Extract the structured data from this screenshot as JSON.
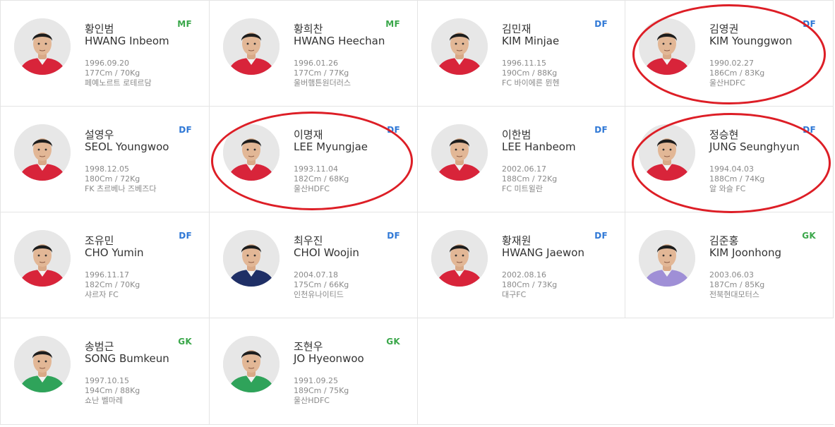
{
  "players": [
    {
      "kname": "황인범",
      "ename": "HWANG Inbeom",
      "pos": "MF",
      "dob": "1996.09.20",
      "body": "177Cm / 70Kg",
      "club": "페예노르트 로테르담",
      "kit": "red"
    },
    {
      "kname": "황희찬",
      "ename": "HWANG Heechan",
      "pos": "MF",
      "dob": "1996.01.26",
      "body": "177Cm / 77Kg",
      "club": "울버햄튼원더러스",
      "kit": "red"
    },
    {
      "kname": "김민재",
      "ename": "KIM Minjae",
      "pos": "DF",
      "dob": "1996.11.15",
      "body": "190Cm / 88Kg",
      "club": "FC 바이에른 뮌헨",
      "kit": "red"
    },
    {
      "kname": "김영권",
      "ename": "KIM Younggwon",
      "pos": "DF",
      "dob": "1990.02.27",
      "body": "186Cm / 83Kg",
      "club": "울산HDFC",
      "kit": "red"
    },
    {
      "kname": "설영우",
      "ename": "SEOL Youngwoo",
      "pos": "DF",
      "dob": "1998.12.05",
      "body": "180Cm / 72Kg",
      "club": "FK 츠르베나 즈베즈다",
      "kit": "red"
    },
    {
      "kname": "이명재",
      "ename": "LEE Myungjae",
      "pos": "DF",
      "dob": "1993.11.04",
      "body": "182Cm / 68Kg",
      "club": "울산HDFC",
      "kit": "red"
    },
    {
      "kname": "이한범",
      "ename": "LEE Hanbeom",
      "pos": "DF",
      "dob": "2002.06.17",
      "body": "188Cm / 72Kg",
      "club": "FC 미트윌란",
      "kit": "red"
    },
    {
      "kname": "정승현",
      "ename": "JUNG Seunghyun",
      "pos": "DF",
      "dob": "1994.04.03",
      "body": "188Cm / 74Kg",
      "club": "알 와슬 FC",
      "kit": "red"
    },
    {
      "kname": "조유민",
      "ename": "CHO Yumin",
      "pos": "DF",
      "dob": "1996.11.17",
      "body": "182Cm / 70Kg",
      "club": "샤르자 FC",
      "kit": "red"
    },
    {
      "kname": "최우진",
      "ename": "CHOI Woojin",
      "pos": "DF",
      "dob": "2004.07.18",
      "body": "175Cm / 66Kg",
      "club": "인천유나이티드",
      "kit": "navy"
    },
    {
      "kname": "황재원",
      "ename": "HWANG Jaewon",
      "pos": "DF",
      "dob": "2002.08.16",
      "body": "180Cm / 73Kg",
      "club": "대구FC",
      "kit": "red"
    },
    {
      "kname": "김준홍",
      "ename": "KIM Joonhong",
      "pos": "GK",
      "dob": "2003.06.03",
      "body": "187Cm / 85Kg",
      "club": "전북현대모터스",
      "kit": "purple"
    },
    {
      "kname": "송범근",
      "ename": "SONG Bumkeun",
      "pos": "GK",
      "dob": "1997.10.15",
      "body": "194Cm / 88Kg",
      "club": "쇼난 벨마레",
      "kit": "green"
    },
    {
      "kname": "조현우",
      "ename": "JO Hyeonwoo",
      "pos": "GK",
      "dob": "1991.09.25",
      "body": "189Cm / 75Kg",
      "club": "울산HDFC",
      "kit": "green"
    }
  ],
  "highlighted": [
    "KIM Younggwon",
    "LEE Myungjae",
    "JUNG Seunghyun"
  ],
  "colors": {
    "mf": "#3aa74a",
    "df": "#2f78d6",
    "gk": "#3aa74a",
    "highlight_ring": "#dd1e26",
    "kit_red": "#d8243a",
    "kit_navy": "#1f2f66",
    "kit_purple": "#9f8fd6",
    "kit_green": "#2fa35a"
  }
}
